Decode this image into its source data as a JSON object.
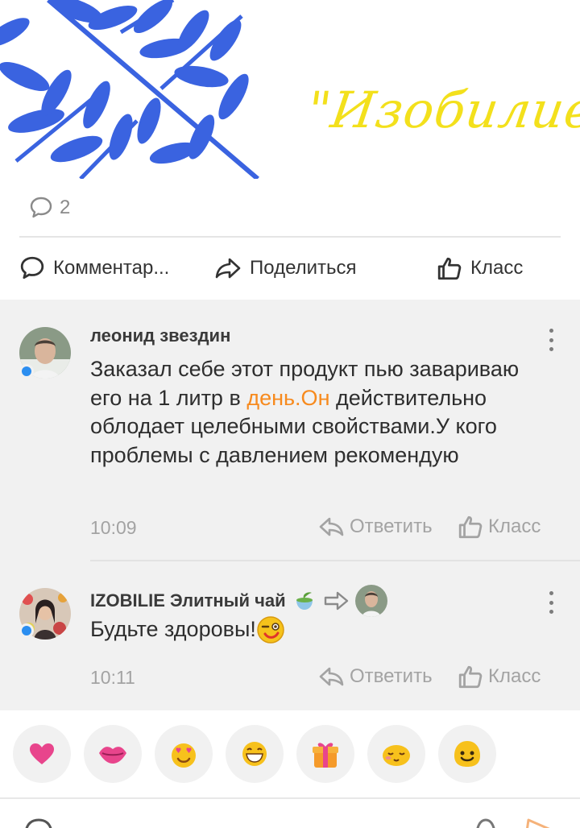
{
  "post": {
    "brand_text": "\"Изобилие\"",
    "comment_count": "2"
  },
  "actions": {
    "comment": "Комментар...",
    "share": "Поделиться",
    "like": "Класс"
  },
  "comments": [
    {
      "author": "леонид звездин",
      "text_before": "Заказал себе этот продукт пью завариваю его на 1 литр в ",
      "text_link": "день.Он",
      "text_after": " действительно облодает целебными свойствами.У кого проблемы с давлением рекомендую",
      "time": "10:09",
      "reply": "Ответить",
      "like": "Класс"
    },
    {
      "author": "IZOBILIE Элитный чай",
      "text": "Будьте здоровы!",
      "time": "10:11",
      "reply": "Ответить",
      "like": "Класс"
    }
  ],
  "reactions": [
    "heart-icon",
    "kiss-lips-icon",
    "heart-eyes-icon",
    "laughing-icon",
    "gift-icon",
    "blush-icon",
    "smile-icon"
  ],
  "colors": {
    "accent_orange": "#f78a1d",
    "brand_yellow": "#f3e01c",
    "leaf_blue": "#3a63e0",
    "online_dot": "#2b8ef0",
    "muted_text": "#a3a3a3"
  }
}
